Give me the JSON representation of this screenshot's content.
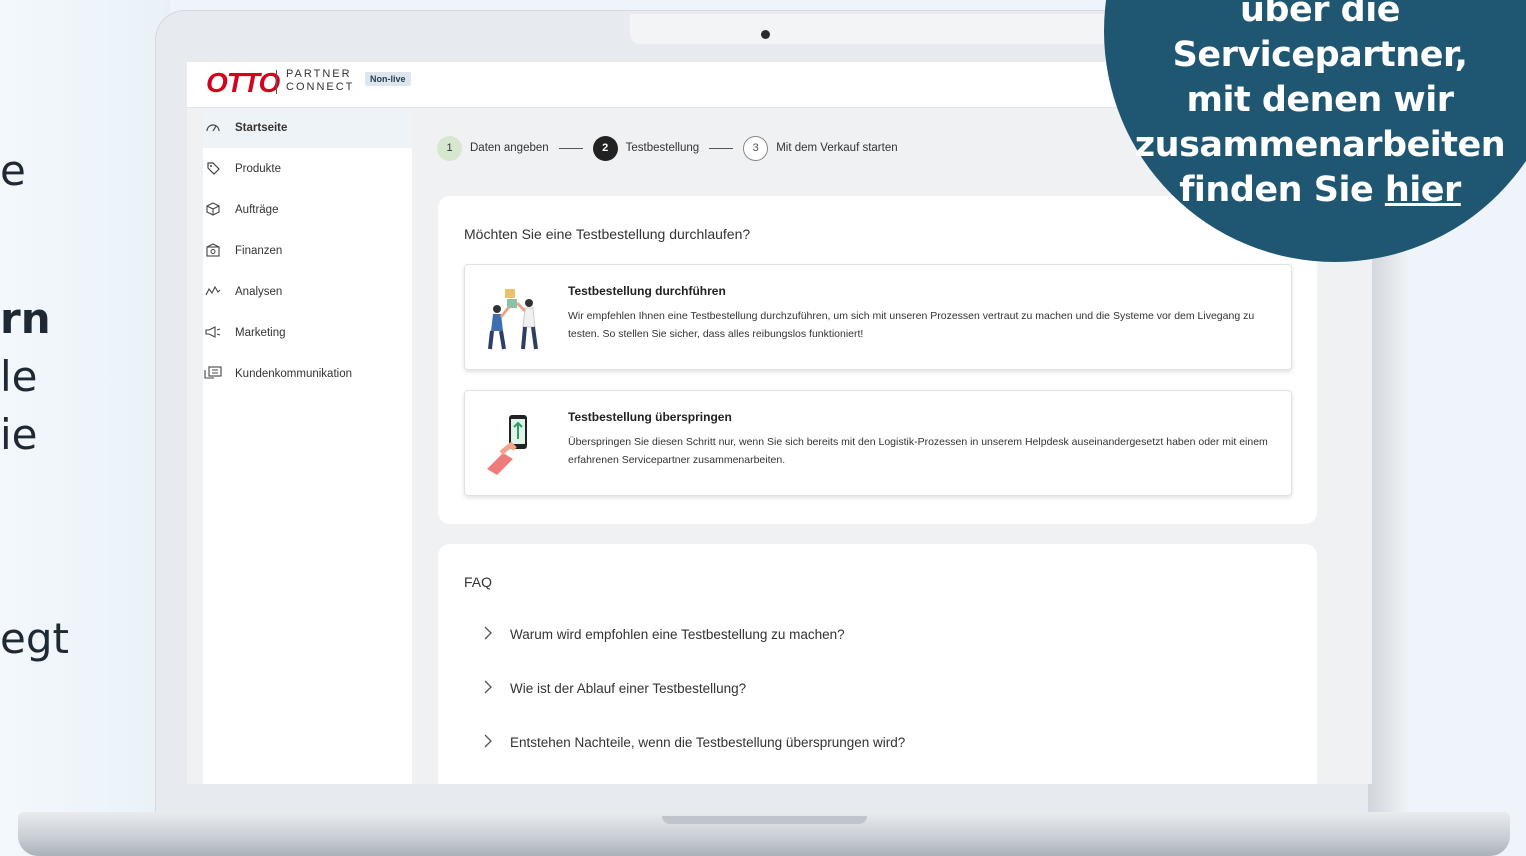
{
  "left_fragments": [
    "e",
    "rn",
    "le",
    "ie",
    "egt"
  ],
  "app": {
    "brand": "OTTO",
    "brand_sub_1": "PARTNER",
    "brand_sub_2": "CONNECT",
    "env_badge": "Non-live"
  },
  "sidebar": {
    "items": [
      {
        "label": "Startseite",
        "icon": "speedometer-icon"
      },
      {
        "label": "Produkte",
        "icon": "tag-icon"
      },
      {
        "label": "Aufträge",
        "icon": "box-icon"
      },
      {
        "label": "Finanzen",
        "icon": "money-icon"
      },
      {
        "label": "Analysen",
        "icon": "chart-line-icon"
      },
      {
        "label": "Marketing",
        "icon": "megaphone-icon"
      },
      {
        "label": "Kundenkommunikation",
        "icon": "chat-icon"
      }
    ]
  },
  "stepper": {
    "steps": [
      {
        "num": "1",
        "label": "Daten angeben",
        "state": "done"
      },
      {
        "num": "2",
        "label": "Testbestellung",
        "state": "current"
      },
      {
        "num": "3",
        "label": "Mit dem Verkauf starten",
        "state": "todo"
      }
    ]
  },
  "main": {
    "question": "Möchten Sie eine Testbestellung durchlaufen?",
    "options": [
      {
        "title": "Testbestellung durchführen",
        "desc": "Wir empfehlen Ihnen eine Testbestellung durchzuführen, um sich mit unseren Prozessen vertraut zu machen und die Systeme vor dem Livegang zu testen. So stellen Sie sicher, dass alles reibungslos funktioniert!"
      },
      {
        "title": "Testbestellung überspringen",
        "desc": "Überspringen Sie diesen Schritt nur, wenn Sie sich bereits mit den Logistik-Prozessen in unserem Helpdesk auseinandergesetzt haben oder mit einem erfahrenen Servicepartner zusammenarbeiten."
      }
    ]
  },
  "faq": {
    "title": "FAQ",
    "items": [
      "Warum wird empfohlen eine Testbestellung zu machen?",
      "Wie ist der Ablauf einer Testbestellung?",
      "Entstehen Nachteile, wenn die Testbestellung übersprungen wird?"
    ]
  },
  "promo": {
    "line1": "über die",
    "line2": "Servicepartner,",
    "line3": "mit denen wir",
    "line4": "zusammenarbeiten",
    "line5_prefix": "finden Sie ",
    "line5_link": "hier"
  },
  "colors": {
    "brand_red": "#d4021d",
    "promo_bg": "#1f5773",
    "step_done": "#d7e6cf"
  }
}
